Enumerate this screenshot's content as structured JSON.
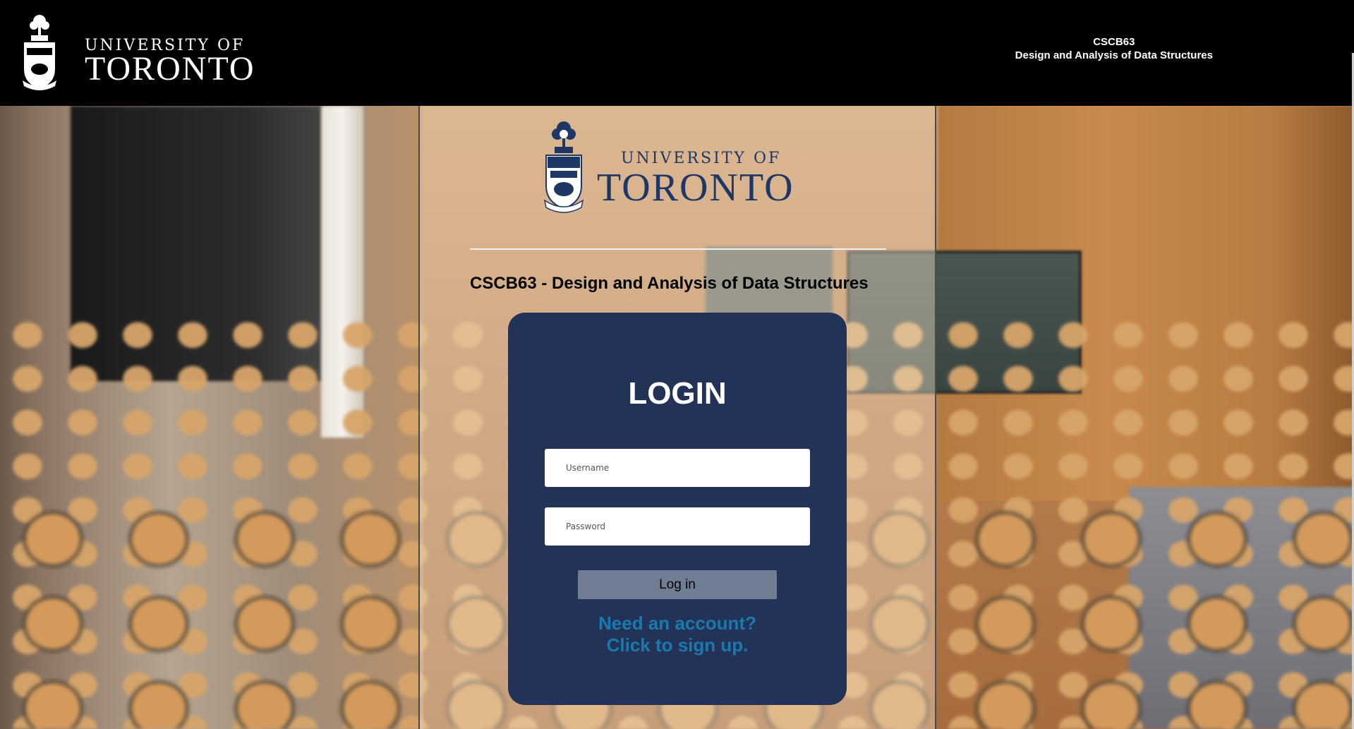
{
  "header": {
    "logo_small": "UNIVERSITY OF",
    "logo_big": "TORONTO",
    "course_code": "CSCB63",
    "course_name": "Design and Analysis of Data Structures"
  },
  "main": {
    "logo_small": "UNIVERSITY OF",
    "logo_big": "TORONTO",
    "course_heading": "CSCB63 - Design and Analysis of Data Structures"
  },
  "login": {
    "title": "LOGIN",
    "username_placeholder": "Username",
    "password_placeholder": "Password",
    "submit_label": "Log in",
    "signup_line1": "Need an account?",
    "signup_line2": "Click to sign up."
  },
  "colors": {
    "card": "#233257",
    "uoft_blue": "#1e3765",
    "link": "#1b7aad",
    "button": "#6f7e92"
  }
}
